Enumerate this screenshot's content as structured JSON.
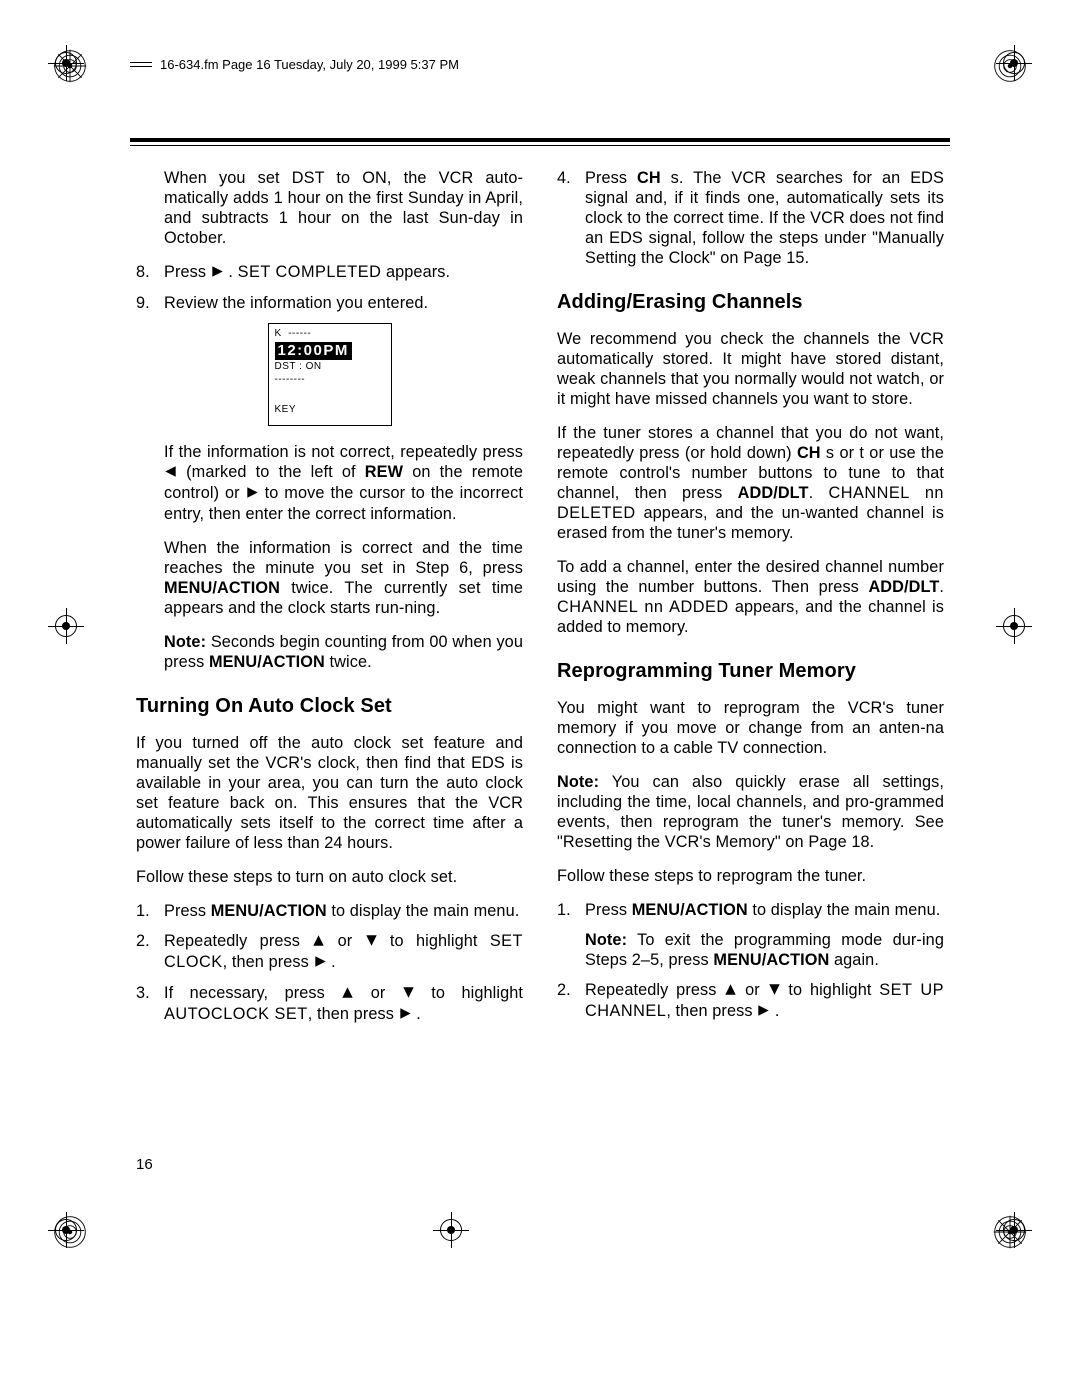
{
  "header": {
    "line": "16-634.fm  Page 16  Tuesday, July 20, 1999  5:37 PM"
  },
  "left": {
    "dst_para": [
      "When you set ",
      "DST",
      " to ",
      "ON",
      ", the VCR auto-matically adds 1 hour on the first Sunday in April, and subtracts 1 hour on the last Sun-day in October."
    ],
    "steps_cont": [
      {
        "n": "8.",
        "frags": [
          "Press ",
          {
            "glyph": "play"
          },
          " . ",
          {
            "osd": "SET COMPLETED"
          },
          " appears."
        ]
      },
      {
        "n": "9.",
        "frags": [
          "Review the information you entered."
        ]
      }
    ],
    "clock": {
      "l1": "K  ------",
      "time": "12:00PM",
      "l2": "DST : ON",
      "l3": "--------",
      "l4": "KEY"
    },
    "after_clock": [
      [
        "If the information is not correct, repeatedly press ",
        {
          "glyph": "rew"
        },
        " (marked to the left of ",
        {
          "b": "REW"
        },
        " on the remote control) or ",
        {
          "glyph": "play"
        },
        " to move the cursor to the incorrect entry, then enter the correct information."
      ],
      [
        "When the information is correct and the time reaches the minute you set in Step 6, press ",
        {
          "b": "MENU/ACTION"
        },
        " twice. The currently set time appears and the clock starts run-ning."
      ],
      [
        {
          "b": "Note:"
        },
        " Seconds begin counting from 00 when you press ",
        {
          "b": "MENU/ACTION"
        },
        " twice."
      ]
    ],
    "h_auto": "Turning On Auto Clock Set",
    "auto_intro": "If you turned off the auto clock set feature and manually set the VCR's clock, then find that EDS is available in your area, you can turn the auto clock set feature back on. This ensures that the VCR automatically sets itself to the correct time after a power failure of less than 24 hours.",
    "auto_lead": "Follow these steps to turn on auto clock set.",
    "auto_steps": [
      {
        "n": "1.",
        "frags": [
          "Press ",
          {
            "b": "MENU/ACTION"
          },
          " to display the main menu."
        ]
      },
      {
        "n": "2.",
        "frags": [
          "Repeatedly press ",
          {
            "glyph": "up"
          },
          " or ",
          {
            "glyph": "down"
          },
          " to highlight ",
          {
            "osd": "SET CLOCK"
          },
          ", then press ",
          {
            "glyph": "play"
          },
          " ."
        ]
      },
      {
        "n": "3.",
        "frags": [
          "If necessary, press ",
          {
            "glyph": "up"
          },
          " or ",
          {
            "glyph": "down"
          },
          " to highlight ",
          {
            "osd": "AUTOCLOCK SET"
          },
          ", then press ",
          {
            "glyph": "play"
          },
          " ."
        ]
      }
    ]
  },
  "right": {
    "step4": {
      "n": "4.",
      "frags": [
        "Press ",
        {
          "b": "CH"
        },
        " s. The VCR searches for an EDS signal and, if it finds one, automatically sets its clock to the correct time. If the VCR does not find an EDS signal, follow the steps under \"Manually Setting the Clock\" on Page 15."
      ]
    },
    "h_add": "Adding/Erasing Channels",
    "add_p1": "We recommend you check the channels the VCR automatically stored. It might have stored distant, weak channels that you normally would not watch, or it might have missed channels you want to store.",
    "add_p2": [
      "If the tuner stores a channel that you do not want, repeatedly press (or hold down) ",
      {
        "b": "CH"
      },
      " s or t or use the remote control's number buttons to tune to that channel, then press ",
      {
        "b": "ADD/DLT"
      },
      ". ",
      {
        "osd": "CHANNEL nn DELETED"
      },
      " appears, and the un-wanted channel is erased from the tuner's memory."
    ],
    "add_p3": [
      "To add a channel, enter the desired channel number using the number buttons. Then press ",
      {
        "b": "ADD/DLT"
      },
      ". ",
      {
        "osd": "CHANNEL nn ADDED"
      },
      " appears, and the channel is added to memory."
    ],
    "h_rep": "Reprogramming Tuner Memory",
    "rep_p1": "You might want to reprogram the VCR's tuner memory if you move or change from an anten-na connection to a cable TV connection.",
    "rep_p2": [
      {
        "b": "Note:"
      },
      " You can also quickly erase all settings, including the time, local channels, and pro-grammed events, then reprogram the tuner's memory. See \"Resetting the VCR's Memory\" on Page 18."
    ],
    "rep_lead": "Follow these steps to reprogram the tuner.",
    "rep_steps": [
      {
        "n": "1.",
        "frags": [
          "Press ",
          {
            "b": "MENU/ACTION"
          },
          " to display the main menu."
        ],
        "note": [
          {
            "b": "Note:"
          },
          " To exit the programming mode dur-ing Steps 2–5, press ",
          {
            "b": "MENU/ACTION"
          },
          " again."
        ]
      },
      {
        "n": "2.",
        "frags": [
          "Repeatedly press ",
          {
            "glyph": "up"
          },
          " or ",
          {
            "glyph": "down"
          },
          " to highlight ",
          {
            "osd": "SET UP CHANNEL"
          },
          ", then press ",
          {
            "glyph": "play"
          },
          " ."
        ]
      }
    ]
  },
  "page_number": "16"
}
